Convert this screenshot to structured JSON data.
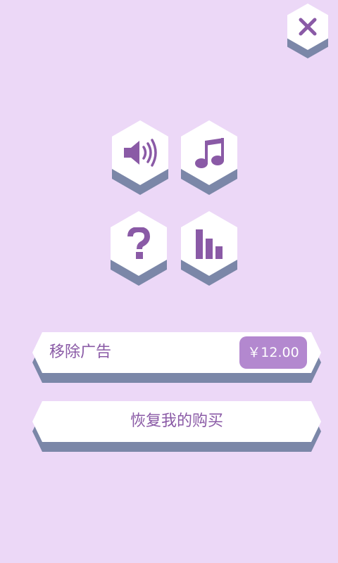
{
  "colors": {
    "background": "#ecd8f7",
    "tile_face": "#ffffff",
    "tile_shadow": "#7b87a8",
    "icon": "#8a5aa6",
    "price_badge": "#b388cf"
  },
  "icons": {
    "close": "close-icon",
    "sound": "speaker-icon",
    "music": "music-note-icon",
    "help": "question-mark-icon",
    "stats": "bar-chart-icon"
  },
  "remove_ads": {
    "label": "移除广告",
    "price": "￥12.00"
  },
  "restore_purchase": {
    "label": "恢复我的购买"
  }
}
